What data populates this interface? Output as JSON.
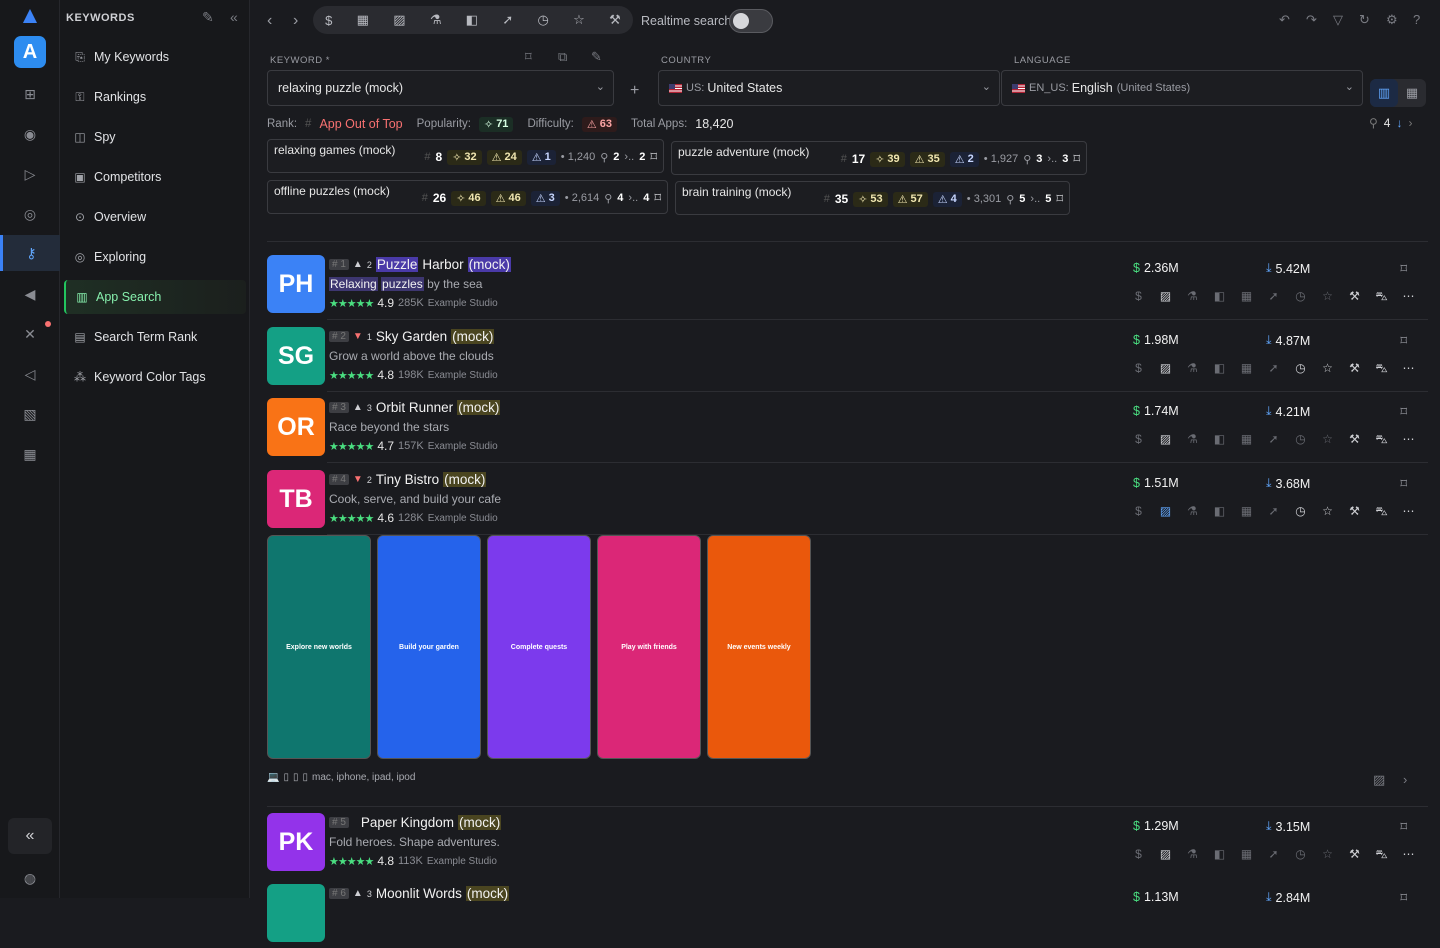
{
  "sidebar": {
    "header": "KEYWORDS",
    "items": [
      {
        "label": "My Keywords",
        "icon": "bookmark-icon",
        "glyph": "⎘"
      },
      {
        "label": "Rankings",
        "icon": "key-icon",
        "glyph": "⚿"
      },
      {
        "label": "Spy",
        "icon": "spy-icon",
        "glyph": "◫"
      },
      {
        "label": "Competitors",
        "icon": "competitors-icon",
        "glyph": "▣"
      },
      {
        "label": "Overview",
        "icon": "overview-icon",
        "glyph": "⊙"
      },
      {
        "label": "Exploring",
        "icon": "compass-icon",
        "glyph": "◎"
      },
      {
        "label": "App Search",
        "icon": "chart-icon",
        "glyph": "▥"
      },
      {
        "label": "Search Term Rank",
        "icon": "document-icon",
        "glyph": "▤"
      },
      {
        "label": "Keyword Color Tags",
        "icon": "tags-icon",
        "glyph": "⁂"
      }
    ]
  },
  "toolbar": {
    "realtime_label": "Realtime search"
  },
  "keyword": {
    "label": "KEYWORD *",
    "value": "relaxing puzzle (mock)"
  },
  "country": {
    "label": "COUNTRY",
    "code": "US:",
    "value": "United States"
  },
  "language": {
    "label": "LANGUAGE",
    "code": "EN_US:",
    "value": "English",
    "sub": "(United States)"
  },
  "stats": {
    "rank_label": "Rank:",
    "rank_hash": "#",
    "rank_value": "App Out of Top",
    "pop_label": "Popularity:",
    "pop_value": "71",
    "diff_label": "Difficulty:",
    "diff_value": "63",
    "total_label": "Total Apps:",
    "total_value": "18,420",
    "count": "4"
  },
  "related": [
    {
      "name": "relaxing games (mock)",
      "rank": "8",
      "pop": "32",
      "diff": "24",
      "c": "1",
      "apps": "1,240",
      "a": "2",
      "b": "2"
    },
    {
      "name": "puzzle adventure (mock)",
      "rank": "17",
      "pop": "39",
      "diff": "35",
      "c": "2",
      "apps": "1,927",
      "a": "3",
      "b": "3"
    },
    {
      "name": "offline puzzles (mock)",
      "rank": "26",
      "pop": "46",
      "diff": "46",
      "c": "3",
      "apps": "2,614",
      "a": "4",
      "b": "4"
    },
    {
      "name": "brain training (mock)",
      "rank": "35",
      "pop": "53",
      "diff": "57",
      "c": "4",
      "apps": "3,301",
      "a": "5",
      "b": "5"
    }
  ],
  "apps": [
    {
      "initials": "PH",
      "color": "#3b82f6",
      "rank": "# 1",
      "dir": "▲",
      "delta": "2",
      "name_a": "Puzzle",
      "name_b": "Harbor",
      "mock": "(mock)",
      "sub_a": "Relaxing",
      "sub_b": "puzzles",
      "sub_c": "by the sea",
      "rating": "4.9",
      "reviews": "285K",
      "dev": "Example Studio",
      "revenue": "2.36M",
      "downloads": "5.42M"
    },
    {
      "initials": "SG",
      "color": "#14a085",
      "rank": "# 2",
      "dir": "▼",
      "delta": "1",
      "name_a": "",
      "name_b": "Sky Garden",
      "mock": "(mock)",
      "sub_a": "",
      "sub_b": "",
      "sub_c": "Grow a world above the clouds",
      "rating": "4.8",
      "reviews": "198K",
      "dev": "Example Studio",
      "revenue": "1.98M",
      "downloads": "4.87M"
    },
    {
      "initials": "OR",
      "color": "#f97316",
      "rank": "# 3",
      "dir": "▲",
      "delta": "3",
      "name_a": "",
      "name_b": "Orbit Runner",
      "mock": "(mock)",
      "sub_a": "",
      "sub_b": "",
      "sub_c": "Race beyond the stars",
      "rating": "4.7",
      "reviews": "157K",
      "dev": "Example Studio",
      "revenue": "1.74M",
      "downloads": "4.21M"
    },
    {
      "initials": "TB",
      "color": "#db2777",
      "rank": "# 4",
      "dir": "▼",
      "delta": "2",
      "name_a": "",
      "name_b": "Tiny Bistro",
      "mock": "(mock)",
      "sub_a": "",
      "sub_b": "",
      "sub_c": "Cook, serve, and build your cafe",
      "rating": "4.6",
      "reviews": "128K",
      "dev": "Example Studio",
      "revenue": "1.51M",
      "downloads": "3.68M"
    },
    {
      "initials": "PK",
      "color": "#9333ea",
      "rank": "# 5",
      "dir": "",
      "delta": "",
      "name_a": "",
      "name_b": "Paper Kingdom",
      "mock": "(mock)",
      "sub_a": "",
      "sub_b": "",
      "sub_c": "Fold heroes. Shape adventures.",
      "rating": "4.8",
      "reviews": "113K",
      "dev": "Example Studio",
      "revenue": "1.29M",
      "downloads": "3.15M"
    },
    {
      "initials": "",
      "color": "#14a085",
      "rank": "# 6",
      "dir": "▲",
      "delta": "3",
      "name_a": "",
      "name_b": "Moonlit Words",
      "mock": "(mock)",
      "sub_a": "",
      "sub_b": "",
      "sub_c": "",
      "rating": "",
      "reviews": "",
      "dev": "",
      "revenue": "1.13M",
      "downloads": "2.84M"
    }
  ],
  "screenshots": [
    {
      "text": "Explore new worlds",
      "color": "#0f766e"
    },
    {
      "text": "Build your garden",
      "color": "#2563eb"
    },
    {
      "text": "Complete quests",
      "color": "#7c3aed"
    },
    {
      "text": "Play with friends",
      "color": "#db2777"
    },
    {
      "text": "New events weekly",
      "color": "#ea580c"
    }
  ],
  "devices": "mac, iphone, ipad, ipod"
}
